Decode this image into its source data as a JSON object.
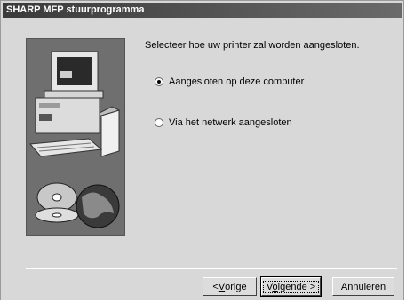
{
  "window": {
    "title": "SHARP MFP stuurprogramma"
  },
  "content": {
    "prompt": "Selecteer hoe uw printer zal worden aangesloten.",
    "options": [
      {
        "label": "Aangesloten op deze computer",
        "selected": true
      },
      {
        "label": "Via het netwerk aangesloten",
        "selected": false
      }
    ]
  },
  "buttons": {
    "back": {
      "prefix": "< ",
      "mnemonic": "V",
      "rest": "orige"
    },
    "next": {
      "prefix": "V",
      "mnemonic": "o",
      "rest": "lgende >"
    },
    "cancel": "Annuleren"
  },
  "graphic": {
    "icon": "computer-and-cd-icon",
    "colors": {
      "panel": "#6f6f6f",
      "monitor": "#e6e6e6",
      "screen": "#2a2a2a"
    }
  }
}
